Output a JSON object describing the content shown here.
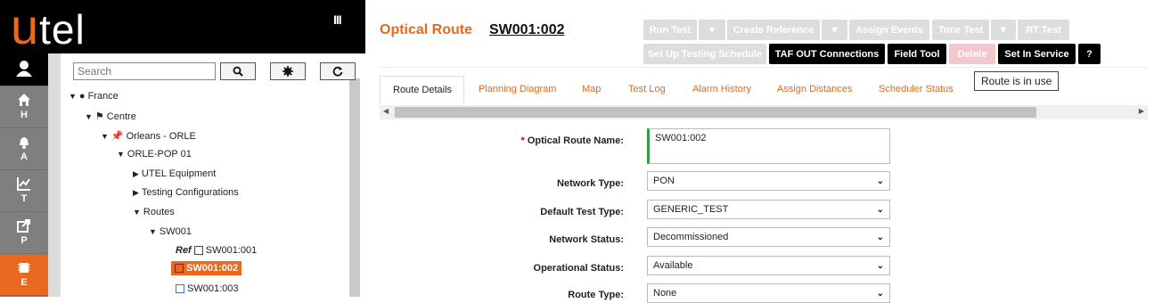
{
  "brand": {
    "logo_u": "u",
    "logo_rest": "tel"
  },
  "sidebar": {
    "menu_toggle": "III",
    "items": [
      {
        "icon": "user-icon",
        "label": ""
      },
      {
        "icon": "home-icon",
        "label": "H"
      },
      {
        "icon": "bell-icon",
        "label": "A"
      },
      {
        "icon": "chart-icon",
        "label": "T"
      },
      {
        "icon": "share-icon",
        "label": "P"
      },
      {
        "icon": "chip-icon",
        "label": "E"
      }
    ]
  },
  "tree": {
    "search_placeholder": "Search",
    "nodes": [
      {
        "label": "France"
      },
      {
        "label": "Centre"
      },
      {
        "label": "Orleans - ORLE"
      },
      {
        "label": "ORLE-POP 01"
      },
      {
        "label": "UTEL Equipment"
      },
      {
        "label": "Testing Configurations"
      },
      {
        "label": "Routes"
      },
      {
        "label": "SW001"
      },
      {
        "label": "SW001:001",
        "prefix": "Ref"
      },
      {
        "label": "SW001:002"
      },
      {
        "label": "SW001:003"
      }
    ]
  },
  "header": {
    "title": "Optical Route",
    "route_id": "SW001:002"
  },
  "actions": {
    "run_test": "Run Test",
    "create_reference": "Create Reference",
    "assign_events": "Assign Events",
    "tone_test": "Tone Test",
    "rt_test": "RT Test",
    "set_up_testing_schedule": "Set Up Testing Schedule",
    "taf_out_connections": "TAF OUT Connections",
    "field_tool": "Field Tool",
    "delete": "Delete",
    "set_in_service": "Set In Service",
    "help": "?"
  },
  "tooltip": "Route is in use",
  "tabs": [
    {
      "label": "Route Details"
    },
    {
      "label": "Planning Diagram"
    },
    {
      "label": "Map"
    },
    {
      "label": "Test Log"
    },
    {
      "label": "Alarm History"
    },
    {
      "label": "Assign Distances"
    },
    {
      "label": "Scheduler Status"
    }
  ],
  "form": {
    "required_mark": "*",
    "fields": [
      {
        "label": "Optical Route Name:",
        "value": "SW001:002"
      },
      {
        "label": "Network Type:",
        "value": "PON"
      },
      {
        "label": "Default Test Type:",
        "value": "GENERIC_TEST"
      },
      {
        "label": "Network Status:",
        "value": "Decommissioned"
      },
      {
        "label": "Operational Status:",
        "value": "Available"
      },
      {
        "label": "Route Type:",
        "value": "None"
      }
    ]
  },
  "colors": {
    "accent": "#e8691f",
    "valid": "#2e9e3e",
    "dark": "#000000"
  }
}
